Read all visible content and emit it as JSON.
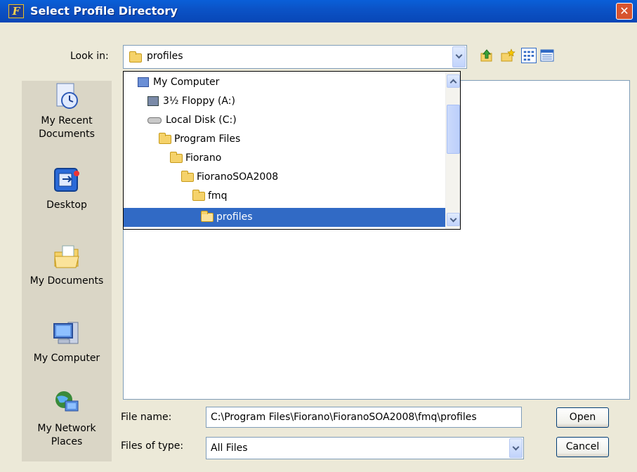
{
  "window": {
    "title": "Select Profile Directory",
    "app_icon_letter": "F",
    "close_symbol": "✕"
  },
  "lookin": {
    "label": "Look in:",
    "value": "profiles"
  },
  "toolbar": {
    "icons": [
      "up-folder-icon",
      "new-folder-icon",
      "list-view-icon",
      "details-view-icon"
    ]
  },
  "places": [
    {
      "label": "My Recent Documents",
      "icon": "recent-documents-icon"
    },
    {
      "label": "Desktop",
      "icon": "desktop-icon"
    },
    {
      "label": "My Documents",
      "icon": "my-documents-icon"
    },
    {
      "label": "My Computer",
      "icon": "my-computer-icon"
    },
    {
      "label": "My Network Places",
      "icon": "network-places-icon"
    }
  ],
  "dropdown": {
    "items": [
      {
        "label": "My Computer",
        "icon": "my-computer-icon"
      },
      {
        "label": "3½ Floppy (A:)",
        "icon": "floppy-drive-icon"
      },
      {
        "label": "Local Disk (C:)",
        "icon": "hard-disk-icon"
      },
      {
        "label": "Program Files",
        "icon": "folder-icon"
      },
      {
        "label": "Fiorano",
        "icon": "folder-icon"
      },
      {
        "label": "FioranoSOA2008",
        "icon": "folder-icon"
      },
      {
        "label": "fmq",
        "icon": "folder-icon"
      },
      {
        "label": "profiles",
        "icon": "open-folder-icon",
        "selected": true
      }
    ]
  },
  "file_name": {
    "label": "File name:",
    "value": "C:\\Program Files\\Fiorano\\FioranoSOA2008\\fmq\\profiles"
  },
  "file_type": {
    "label": "Files of type:",
    "value": "All Files"
  },
  "buttons": {
    "open": "Open",
    "cancel": "Cancel"
  },
  "colors": {
    "title_bar": "#0b53c7",
    "selection": "#316ac5",
    "dialog_bg": "#ece9d8"
  }
}
